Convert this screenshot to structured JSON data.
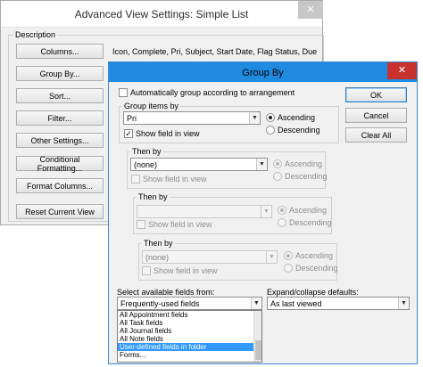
{
  "advanced": {
    "title": "Advanced View Settings: Simple List",
    "close": "✕",
    "description_label": "Description",
    "buttons": [
      {
        "label": "Columns...",
        "value": "Icon, Complete, Pri, Subject, Start Date, Flag Status, Due ..."
      },
      {
        "label": "Group By..."
      },
      {
        "label": "Sort..."
      },
      {
        "label": "Filter..."
      },
      {
        "label": "Other Settings..."
      },
      {
        "label": "Conditional Formatting..."
      },
      {
        "label": "Format Columns..."
      },
      {
        "label": "Reset Current View"
      }
    ]
  },
  "groupby": {
    "title": "Group By",
    "close": "✕",
    "auto_group_label": "Automatically group according to arrangement",
    "ok": "OK",
    "cancel": "Cancel",
    "clear_all": "Clear All",
    "group_items_by_label": "Group items by",
    "levels": [
      {
        "value": "Pri",
        "show_field": "Show field in view",
        "asc": "Ascending",
        "desc": "Descending",
        "checked": true,
        "enabled": true
      },
      {
        "label": "Then by",
        "value": "(none)",
        "show_field": "Show field in view",
        "asc": "Ascending",
        "desc": "Descending",
        "checked": false,
        "enabled": true
      },
      {
        "label": "Then by",
        "value": "",
        "show_field": "Show field in view",
        "asc": "Ascending",
        "desc": "Descending",
        "checked": false,
        "enabled": false
      },
      {
        "label": "Then by",
        "value": "(none)",
        "show_field": "Show field in view",
        "asc": "Ascending",
        "desc": "Descending",
        "checked": false,
        "enabled": false
      }
    ],
    "select_fields_label": "Select available fields from:",
    "select_fields_value": "Frequently-used fields",
    "expand_label": "Expand/collapse defaults:",
    "expand_value": "As last viewed",
    "dropdown_options": [
      "All Appointment fields",
      "All Task fields",
      "All Journal fields",
      "All Note fields",
      "User-defined fields in folder",
      "Forms..."
    ],
    "dropdown_selected_index": 4
  }
}
